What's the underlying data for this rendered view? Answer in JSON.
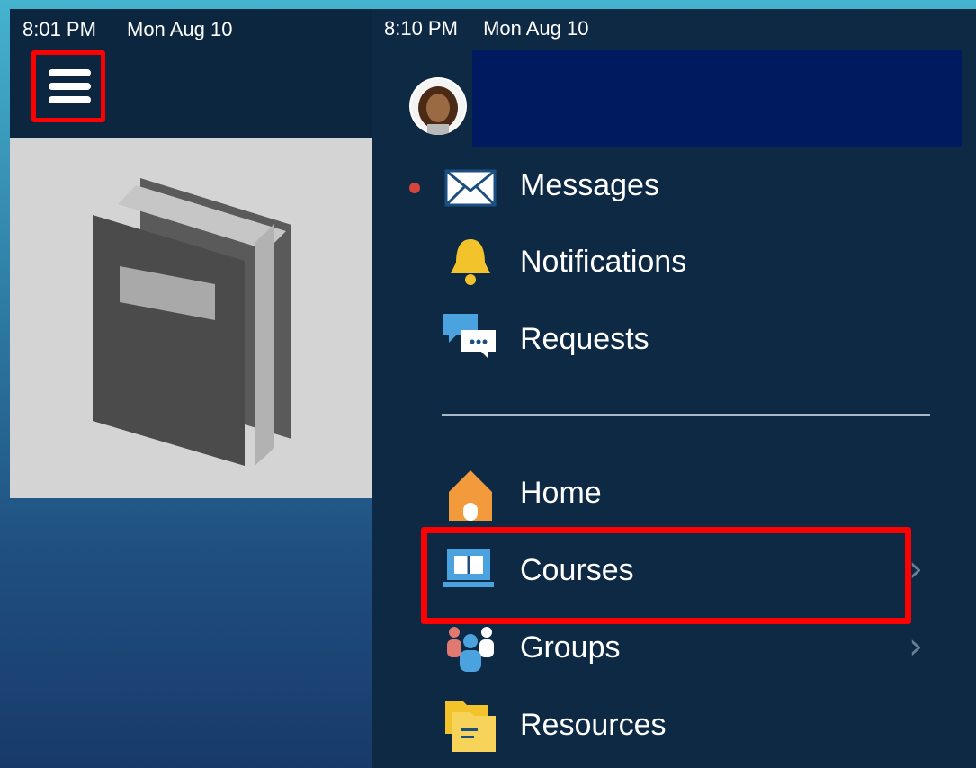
{
  "left": {
    "status": {
      "time": "8:01 PM",
      "date": "Mon Aug 10"
    },
    "stray_mark": ","
  },
  "right": {
    "status": {
      "time": "8:10 PM",
      "date": "Mon Aug 10"
    },
    "menu": {
      "messages": "Messages",
      "notifications": "Notifications",
      "requests": "Requests",
      "home": "Home",
      "courses": "Courses",
      "groups": "Groups",
      "resources": "Resources"
    }
  },
  "colors": {
    "highlight": "#ff0000",
    "panel_bg": "#0e2944",
    "unread_dot": "#d6453d",
    "name_block": "#001a60"
  }
}
